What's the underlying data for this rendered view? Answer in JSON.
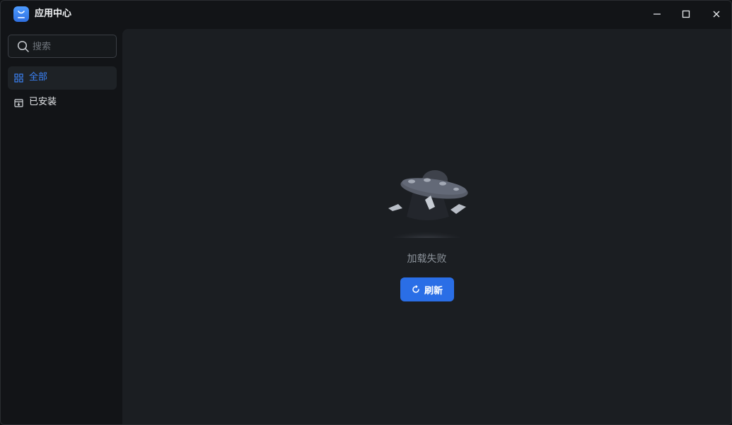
{
  "app": {
    "title": "应用中心",
    "logo_icon": "store-bag-icon",
    "accent": "#2a6ee6"
  },
  "window_controls": {
    "minimize_icon": "minimize-icon",
    "maximize_icon": "maximize-icon",
    "close_icon": "close-icon"
  },
  "sidebar": {
    "search": {
      "placeholder": "搜索",
      "value": "",
      "icon": "search-icon"
    },
    "items": [
      {
        "label": "全部",
        "icon": "grid-icon",
        "active": true
      },
      {
        "label": "已安装",
        "icon": "installed-box-icon",
        "active": false
      }
    ]
  },
  "main": {
    "illustration_icon": "ufo-illustration",
    "error_message": "加载失败",
    "refresh_button": {
      "label": "刷新",
      "icon": "refresh-icon"
    }
  }
}
